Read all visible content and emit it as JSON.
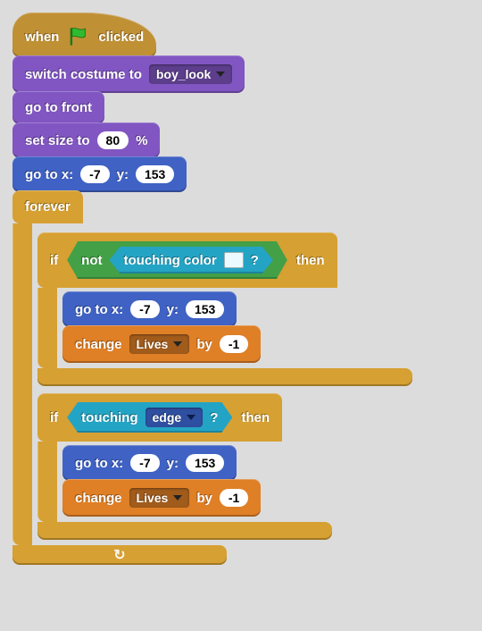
{
  "hat": {
    "when": "when",
    "clicked": "clicked"
  },
  "switch_costume": {
    "label": "switch costume to",
    "value": "boy_look"
  },
  "go_to_front": "go to front",
  "set_size": {
    "label_a": "set size to",
    "value": "80",
    "label_b": "%"
  },
  "goto1": {
    "label_a": "go to x:",
    "x": "-7",
    "label_b": "y:",
    "y": "153"
  },
  "forever": "forever",
  "if1": {
    "if": "if",
    "then": "then",
    "not": "not",
    "touching_color_a": "touching color",
    "touching_color_b": "?",
    "goto": {
      "label_a": "go to x:",
      "x": "-7",
      "label_b": "y:",
      "y": "153"
    },
    "change": {
      "label_a": "change",
      "var": "Lives",
      "label_b": "by",
      "val": "-1"
    }
  },
  "if2": {
    "if": "if",
    "then": "then",
    "touching_a": "touching",
    "touching_target": "edge",
    "touching_b": "?",
    "goto": {
      "label_a": "go to x:",
      "x": "-7",
      "label_b": "y:",
      "y": "153"
    },
    "change": {
      "label_a": "change",
      "var": "Lives",
      "label_b": "by",
      "val": "-1"
    }
  },
  "loop_arrow": "↻",
  "colors": {
    "events": "#c09035",
    "looks": "#8156c2",
    "motion": "#3f62c4",
    "control": "#d6a032",
    "data": "#df7f26",
    "operators": "#43a047",
    "sensing": "#24a4c4"
  }
}
